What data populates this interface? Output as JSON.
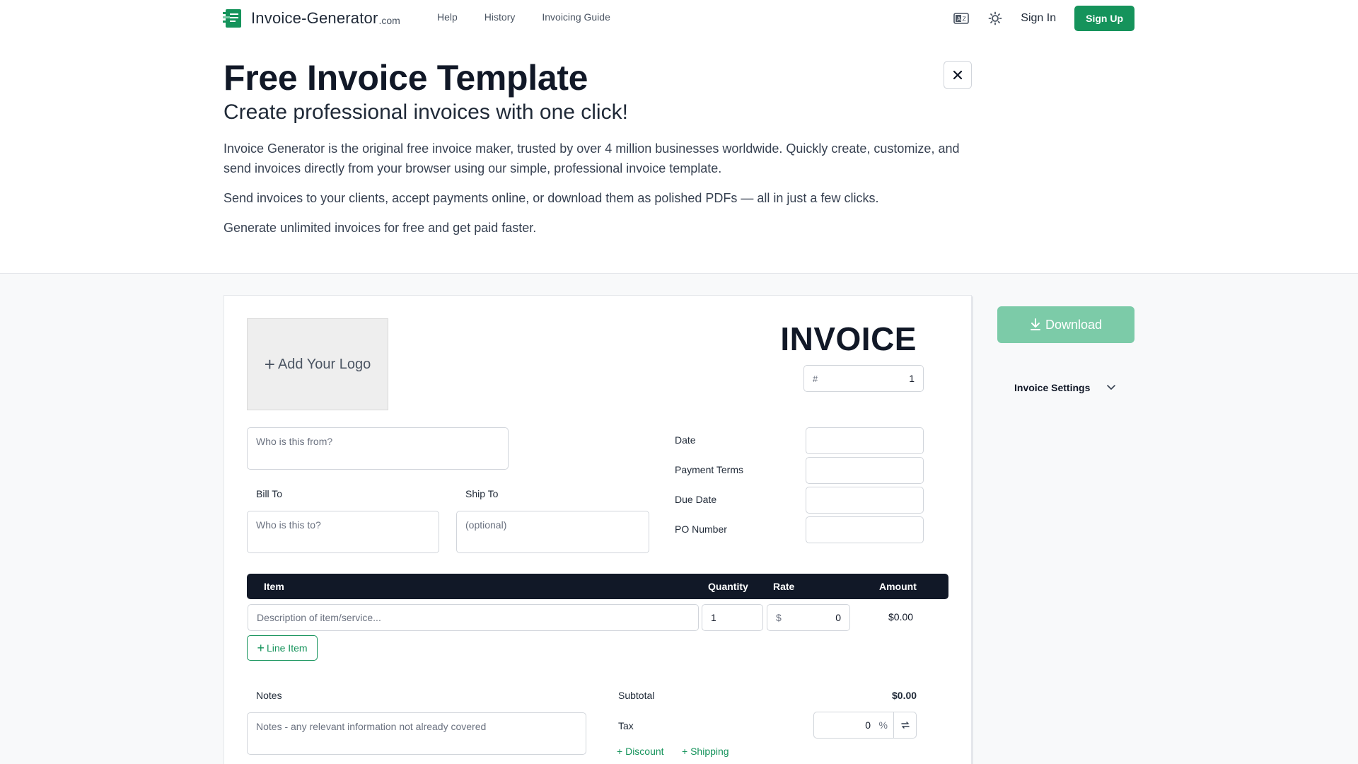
{
  "header": {
    "brand": "Invoice-Generator",
    "brand_suffix": ".com",
    "nav": [
      "Help",
      "History",
      "Invoicing Guide"
    ],
    "sign_in": "Sign In",
    "sign_up": "Sign Up"
  },
  "hero": {
    "title": "Free Invoice Template",
    "subtitle": "Create professional invoices with one click!",
    "paragraph1": "Invoice Generator is the original free invoice maker, trusted by over 4 million businesses worldwide. Quickly create, customize, and send invoices directly from your browser using our simple, professional invoice template.",
    "paragraph2": "Send invoices to your clients, accept payments online, or download them as polished PDFs — all in just a few clicks.",
    "paragraph3": "Generate unlimited invoices for free and get paid faster."
  },
  "invoice": {
    "add_logo": "Add Your Logo",
    "title": "INVOICE",
    "number_prefix": "#",
    "number": "1",
    "from_placeholder": "Who is this from?",
    "bill_to_label": "Bill To",
    "ship_to_label": "Ship To",
    "bill_to_placeholder": "Who is this to?",
    "ship_to_placeholder": "(optional)",
    "date_label": "Date",
    "terms_label": "Payment Terms",
    "due_label": "Due Date",
    "po_label": "PO Number",
    "table_headers": {
      "item": "Item",
      "quantity": "Quantity",
      "rate": "Rate",
      "amount": "Amount"
    },
    "line_item": {
      "description_placeholder": "Description of item/service...",
      "quantity": "1",
      "currency": "$",
      "rate": "0",
      "amount": "$0.00"
    },
    "add_line_item": "Line Item",
    "notes_label": "Notes",
    "notes_placeholder": "Notes - any relevant information not already covered",
    "subtotal_label": "Subtotal",
    "subtotal_value": "$0.00",
    "tax_label": "Tax",
    "tax_value": "0",
    "tax_unit": "%",
    "discount_link": "Discount",
    "shipping_link": "Shipping"
  },
  "sidebar": {
    "download": "Download",
    "settings": "Invoice Settings"
  },
  "colors": {
    "brand_green": "#15935b",
    "download_disabled": "#7ccba8",
    "table_header": "#111827"
  }
}
